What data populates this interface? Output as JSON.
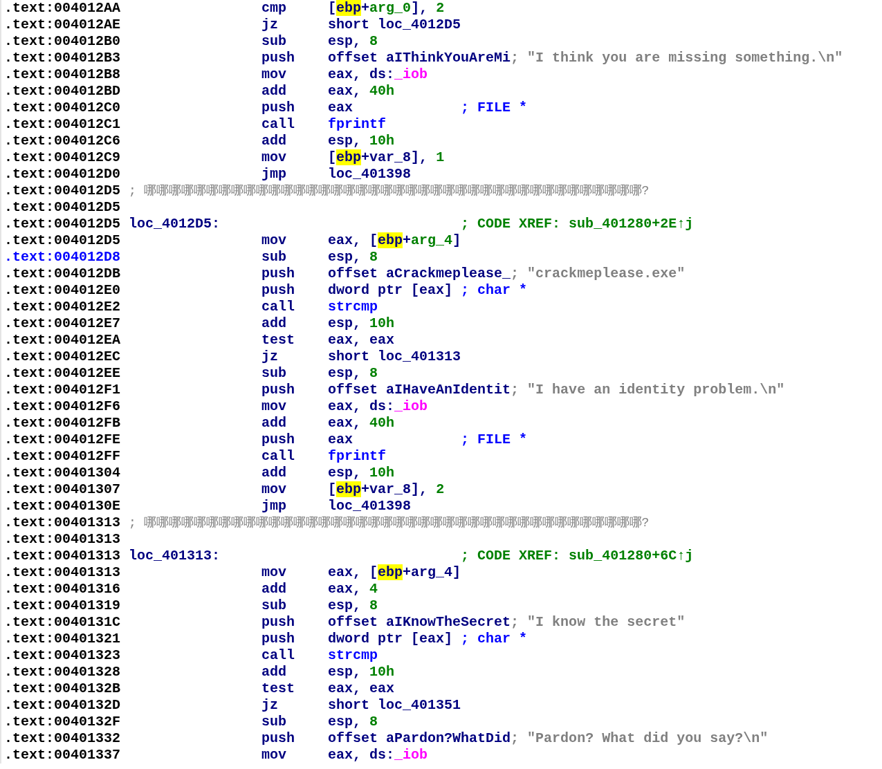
{
  "listing": {
    "lines": [
      {
        "address": ".text:004012AA",
        "selected": false,
        "mnemonic": "cmp",
        "operands": [
          {
            "text": "[",
            "kind": "plain"
          },
          {
            "text": "ebp",
            "kind": "highlight"
          },
          {
            "text": "+",
            "kind": "plain"
          },
          {
            "text": "arg_0",
            "kind": "variable"
          },
          {
            "text": "], ",
            "kind": "plain"
          },
          {
            "text": "2",
            "kind": "number"
          }
        ]
      },
      {
        "address": ".text:004012AE",
        "selected": false,
        "mnemonic": "jz",
        "operands": [
          {
            "text": "short loc_4012D5",
            "kind": "plain"
          }
        ]
      },
      {
        "address": ".text:004012B0",
        "selected": false,
        "mnemonic": "sub",
        "operands": [
          {
            "text": "esp, ",
            "kind": "plain"
          },
          {
            "text": "8",
            "kind": "number"
          }
        ]
      },
      {
        "address": ".text:004012B3",
        "selected": false,
        "mnemonic": "push",
        "operands": [
          {
            "text": "offset aIThinkYouAreMi",
            "kind": "plain"
          }
        ],
        "comment": {
          "text": "; \"I think you are missing something.\\n\"",
          "kind": "string"
        }
      },
      {
        "address": ".text:004012B8",
        "selected": false,
        "mnemonic": "mov",
        "operands": [
          {
            "text": "eax, ds:",
            "kind": "plain"
          },
          {
            "text": "_iob",
            "kind": "import"
          }
        ]
      },
      {
        "address": ".text:004012BD",
        "selected": false,
        "mnemonic": "add",
        "operands": [
          {
            "text": "eax, ",
            "kind": "plain"
          },
          {
            "text": "40h",
            "kind": "number"
          }
        ]
      },
      {
        "address": ".text:004012C0",
        "selected": false,
        "mnemonic": "push",
        "operands": [
          {
            "text": "eax",
            "kind": "plain"
          }
        ],
        "comment": {
          "text": "; FILE *",
          "kind": "type"
        }
      },
      {
        "address": ".text:004012C1",
        "selected": false,
        "mnemonic": "call",
        "operands": [
          {
            "text": "fprintf",
            "kind": "function"
          }
        ]
      },
      {
        "address": ".text:004012C6",
        "selected": false,
        "mnemonic": "add",
        "operands": [
          {
            "text": "esp, ",
            "kind": "plain"
          },
          {
            "text": "10h",
            "kind": "number"
          }
        ]
      },
      {
        "address": ".text:004012C9",
        "selected": false,
        "mnemonic": "mov",
        "operands": [
          {
            "text": "[",
            "kind": "plain"
          },
          {
            "text": "ebp",
            "kind": "highlight"
          },
          {
            "text": "+var_8], ",
            "kind": "plain"
          },
          {
            "text": "1",
            "kind": "number"
          }
        ]
      },
      {
        "address": ".text:004012D0",
        "selected": false,
        "mnemonic": "jmp",
        "operands": [
          {
            "text": "loc_401398",
            "kind": "plain"
          }
        ]
      },
      {
        "address": ".text:004012D5",
        "selected": false,
        "comment": {
          "text": "; 哪哪哪哪哪哪哪哪哪哪哪哪哪哪哪哪哪哪哪哪哪哪哪哪哪哪哪哪哪哪哪哪哪哪哪哪哪哪哪哪?",
          "kind": "separator"
        }
      },
      {
        "address": ".text:004012D5",
        "selected": false
      },
      {
        "address": ".text:004012D5",
        "selected": false,
        "label": "loc_4012D5:",
        "comment": {
          "text": "; CODE XREF: sub_401280+2E↑j",
          "kind": "xref"
        }
      },
      {
        "address": ".text:004012D5",
        "selected": false,
        "mnemonic": "mov",
        "operands": [
          {
            "text": "eax, [",
            "kind": "plain"
          },
          {
            "text": "ebp",
            "kind": "highlight"
          },
          {
            "text": "+",
            "kind": "plain"
          },
          {
            "text": "arg_4",
            "kind": "variable"
          },
          {
            "text": "]",
            "kind": "plain"
          }
        ]
      },
      {
        "address": ".text:004012D8",
        "selected": true,
        "mnemonic": "sub",
        "operands": [
          {
            "text": "esp, ",
            "kind": "plain"
          },
          {
            "text": "8",
            "kind": "number"
          }
        ]
      },
      {
        "address": ".text:004012DB",
        "selected": false,
        "mnemonic": "push",
        "operands": [
          {
            "text": "offset aCrackmeplease_",
            "kind": "plain"
          }
        ],
        "comment": {
          "text": "; \"crackmeplease.exe\"",
          "kind": "string"
        }
      },
      {
        "address": ".text:004012E0",
        "selected": false,
        "mnemonic": "push",
        "operands": [
          {
            "text": "dword ptr [eax]",
            "kind": "plain"
          }
        ],
        "comment": {
          "text": "; char *",
          "kind": "type"
        }
      },
      {
        "address": ".text:004012E2",
        "selected": false,
        "mnemonic": "call",
        "operands": [
          {
            "text": "strcmp",
            "kind": "function"
          }
        ]
      },
      {
        "address": ".text:004012E7",
        "selected": false,
        "mnemonic": "add",
        "operands": [
          {
            "text": "esp, ",
            "kind": "plain"
          },
          {
            "text": "10h",
            "kind": "number"
          }
        ]
      },
      {
        "address": ".text:004012EA",
        "selected": false,
        "mnemonic": "test",
        "operands": [
          {
            "text": "eax, eax",
            "kind": "plain"
          }
        ]
      },
      {
        "address": ".text:004012EC",
        "selected": false,
        "mnemonic": "jz",
        "operands": [
          {
            "text": "short loc_401313",
            "kind": "plain"
          }
        ]
      },
      {
        "address": ".text:004012EE",
        "selected": false,
        "mnemonic": "sub",
        "operands": [
          {
            "text": "esp, ",
            "kind": "plain"
          },
          {
            "text": "8",
            "kind": "number"
          }
        ]
      },
      {
        "address": ".text:004012F1",
        "selected": false,
        "mnemonic": "push",
        "operands": [
          {
            "text": "offset aIHaveAnIdentit",
            "kind": "plain"
          }
        ],
        "comment": {
          "text": "; \"I have an identity problem.\\n\"",
          "kind": "string"
        }
      },
      {
        "address": ".text:004012F6",
        "selected": false,
        "mnemonic": "mov",
        "operands": [
          {
            "text": "eax, ds:",
            "kind": "plain"
          },
          {
            "text": "_iob",
            "kind": "import"
          }
        ]
      },
      {
        "address": ".text:004012FB",
        "selected": false,
        "mnemonic": "add",
        "operands": [
          {
            "text": "eax, ",
            "kind": "plain"
          },
          {
            "text": "40h",
            "kind": "number"
          }
        ]
      },
      {
        "address": ".text:004012FE",
        "selected": false,
        "mnemonic": "push",
        "operands": [
          {
            "text": "eax",
            "kind": "plain"
          }
        ],
        "comment": {
          "text": "; FILE *",
          "kind": "type"
        }
      },
      {
        "address": ".text:004012FF",
        "selected": false,
        "mnemonic": "call",
        "operands": [
          {
            "text": "fprintf",
            "kind": "function"
          }
        ]
      },
      {
        "address": ".text:00401304",
        "selected": false,
        "mnemonic": "add",
        "operands": [
          {
            "text": "esp, ",
            "kind": "plain"
          },
          {
            "text": "10h",
            "kind": "number"
          }
        ]
      },
      {
        "address": ".text:00401307",
        "selected": false,
        "mnemonic": "mov",
        "operands": [
          {
            "text": "[",
            "kind": "plain"
          },
          {
            "text": "ebp",
            "kind": "highlight"
          },
          {
            "text": "+var_8], ",
            "kind": "plain"
          },
          {
            "text": "2",
            "kind": "number"
          }
        ]
      },
      {
        "address": ".text:0040130E",
        "selected": false,
        "mnemonic": "jmp",
        "operands": [
          {
            "text": "loc_401398",
            "kind": "plain"
          }
        ]
      },
      {
        "address": ".text:00401313",
        "selected": false,
        "comment": {
          "text": "; 哪哪哪哪哪哪哪哪哪哪哪哪哪哪哪哪哪哪哪哪哪哪哪哪哪哪哪哪哪哪哪哪哪哪哪哪哪哪哪哪?",
          "kind": "separator"
        }
      },
      {
        "address": ".text:00401313",
        "selected": false
      },
      {
        "address": ".text:00401313",
        "selected": false,
        "label": "loc_401313:",
        "comment": {
          "text": "; CODE XREF: sub_401280+6C↑j",
          "kind": "xref"
        }
      },
      {
        "address": ".text:00401313",
        "selected": false,
        "mnemonic": "mov",
        "operands": [
          {
            "text": "eax, [",
            "kind": "plain"
          },
          {
            "text": "ebp",
            "kind": "highlight"
          },
          {
            "text": "+arg_4]",
            "kind": "plain"
          }
        ]
      },
      {
        "address": ".text:00401316",
        "selected": false,
        "mnemonic": "add",
        "operands": [
          {
            "text": "eax, ",
            "kind": "plain"
          },
          {
            "text": "4",
            "kind": "number"
          }
        ]
      },
      {
        "address": ".text:00401319",
        "selected": false,
        "mnemonic": "sub",
        "operands": [
          {
            "text": "esp, ",
            "kind": "plain"
          },
          {
            "text": "8",
            "kind": "number"
          }
        ]
      },
      {
        "address": ".text:0040131C",
        "selected": false,
        "mnemonic": "push",
        "operands": [
          {
            "text": "offset aIKnowTheSecret",
            "kind": "plain"
          }
        ],
        "comment": {
          "text": "; \"I know the secret\"",
          "kind": "string"
        }
      },
      {
        "address": ".text:00401321",
        "selected": false,
        "mnemonic": "push",
        "operands": [
          {
            "text": "dword ptr [eax]",
            "kind": "plain"
          }
        ],
        "comment": {
          "text": "; char *",
          "kind": "type"
        }
      },
      {
        "address": ".text:00401323",
        "selected": false,
        "mnemonic": "call",
        "operands": [
          {
            "text": "strcmp",
            "kind": "function"
          }
        ]
      },
      {
        "address": ".text:00401328",
        "selected": false,
        "mnemonic": "add",
        "operands": [
          {
            "text": "esp, ",
            "kind": "plain"
          },
          {
            "text": "10h",
            "kind": "number"
          }
        ]
      },
      {
        "address": ".text:0040132B",
        "selected": false,
        "mnemonic": "test",
        "operands": [
          {
            "text": "eax, eax",
            "kind": "plain"
          }
        ]
      },
      {
        "address": ".text:0040132D",
        "selected": false,
        "mnemonic": "jz",
        "operands": [
          {
            "text": "short loc_401351",
            "kind": "plain"
          }
        ]
      },
      {
        "address": ".text:0040132F",
        "selected": false,
        "mnemonic": "sub",
        "operands": [
          {
            "text": "esp, ",
            "kind": "plain"
          },
          {
            "text": "8",
            "kind": "number"
          }
        ]
      },
      {
        "address": ".text:00401332",
        "selected": false,
        "mnemonic": "push",
        "operands": [
          {
            "text": "offset aPardon?WhatDid",
            "kind": "plain"
          }
        ],
        "comment": {
          "text": "; \"Pardon? What did you say?\\n\"",
          "kind": "string"
        }
      },
      {
        "address": ".text:00401337",
        "selected": false,
        "mnemonic": "mov",
        "operands": [
          {
            "text": "eax, ds:",
            "kind": "plain"
          },
          {
            "text": "_iob",
            "kind": "import"
          }
        ]
      }
    ]
  }
}
